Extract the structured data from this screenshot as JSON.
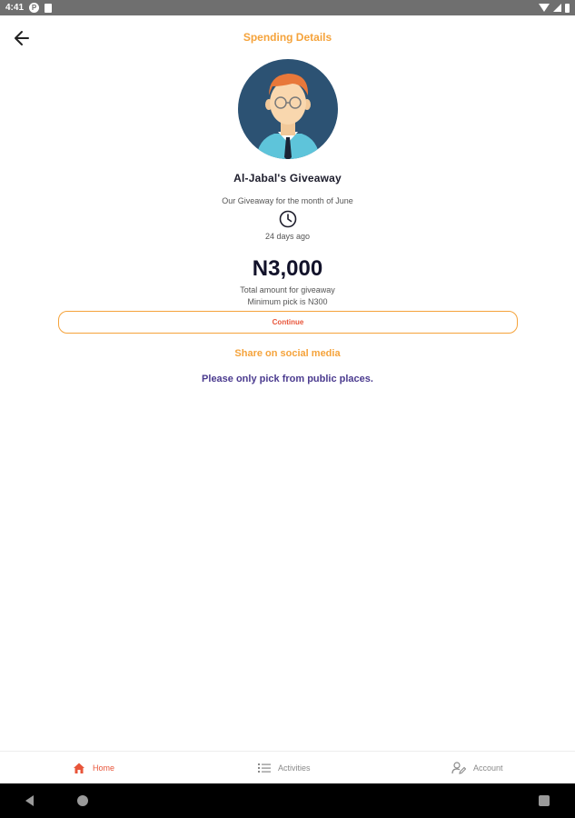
{
  "status_bar": {
    "time": "4:41",
    "app_icon_letter": "P"
  },
  "header": {
    "title": "Spending Details",
    "back_icon": "arrow-left-icon"
  },
  "giveaway": {
    "name": "Al-Jabal's Giveaway",
    "description": "Our Giveaway for the month of June",
    "time_ago": "24 days ago",
    "amount": "N3,000",
    "total_label": "Total amount for giveaway",
    "minimum_pick": "Minimum pick is N300"
  },
  "actions": {
    "continue_label": "Continue",
    "share_label": "Share on social media"
  },
  "notice": "Please only pick from public places.",
  "bottom_nav": {
    "items": [
      {
        "label": "Home",
        "icon": "home-icon",
        "active": true
      },
      {
        "label": "Activities",
        "icon": "list-icon",
        "active": false
      },
      {
        "label": "Account",
        "icon": "user-edit-icon",
        "active": false
      }
    ]
  },
  "colors": {
    "accent_orange": "#f5a33b",
    "active_red": "#e8553a",
    "notice_purple": "#4b3b8f",
    "avatar_bg": "#2c5273"
  }
}
